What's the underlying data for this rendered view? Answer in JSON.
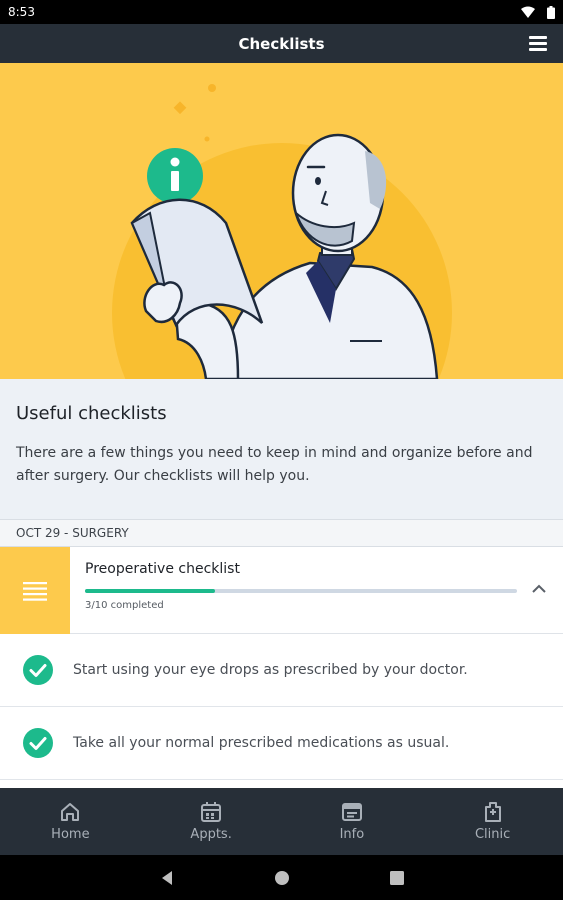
{
  "status_bar": {
    "time": "8:53"
  },
  "app_bar": {
    "title": "Checklists"
  },
  "intro": {
    "heading": "Useful checklists",
    "description": "There are a few things you need to keep in mind and organize before and after surgery. Our checklists will help you."
  },
  "section": {
    "label": "OCT 29 - SURGERY"
  },
  "checklist": {
    "title": "Preoperative checklist",
    "progress_text": "3/10 completed",
    "completed": 3,
    "total": 10
  },
  "tasks": [
    {
      "text": "Start using your eye drops as prescribed by your doctor."
    },
    {
      "text": "Take all your normal prescribed medications as usual."
    }
  ],
  "bottom_nav": [
    {
      "label": "Home",
      "icon": "home-icon"
    },
    {
      "label": "Appts.",
      "icon": "calendar-icon"
    },
    {
      "label": "Info",
      "icon": "info-document-icon"
    },
    {
      "label": "Clinic",
      "icon": "clinic-icon"
    }
  ],
  "colors": {
    "accent_yellow": "#fdca4c",
    "progress_green": "#1dba8c",
    "dark_bar": "#272f38"
  }
}
